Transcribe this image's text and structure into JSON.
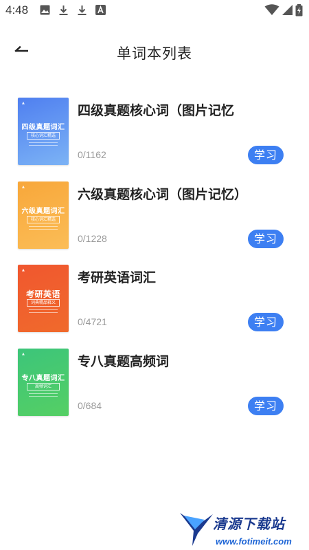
{
  "status_bar": {
    "time": "4:48"
  },
  "header": {
    "title": "单词本列表"
  },
  "books": [
    {
      "name": "四级真题核心词（图片记忆",
      "progress": "0/1162",
      "action": "学习",
      "cover_title": "四级真题词汇",
      "cover_subtitle": "核心词汇精选",
      "cover_color_top": "#4f7ff0",
      "cover_color_bottom": "#7cb3f5"
    },
    {
      "name": "六级真题核心词（图片记忆）",
      "progress": "0/1228",
      "action": "学习",
      "cover_title": "六级真题词汇",
      "cover_subtitle": "核心词汇精选",
      "cover_color_top": "#f8a73a",
      "cover_color_bottom": "#fbbd57"
    },
    {
      "name": "考研英语词汇",
      "progress": "0/4721",
      "action": "学习",
      "cover_title": "考研英语",
      "cover_subtitle": "词典精品释义",
      "cover_color_top": "#f0572f",
      "cover_color_bottom": "#f06a2c"
    },
    {
      "name": "专八真题高频词",
      "progress": "0/684",
      "action": "学习",
      "cover_title": "专八真题词汇",
      "cover_subtitle": "高频词汇",
      "cover_color_top": "#3cc57a",
      "cover_color_bottom": "#55cf64"
    }
  ],
  "watermark": {
    "name": "清源下载站",
    "url": "www.fotimeit.com"
  },
  "colors": {
    "accent": "#3d7ff2"
  }
}
